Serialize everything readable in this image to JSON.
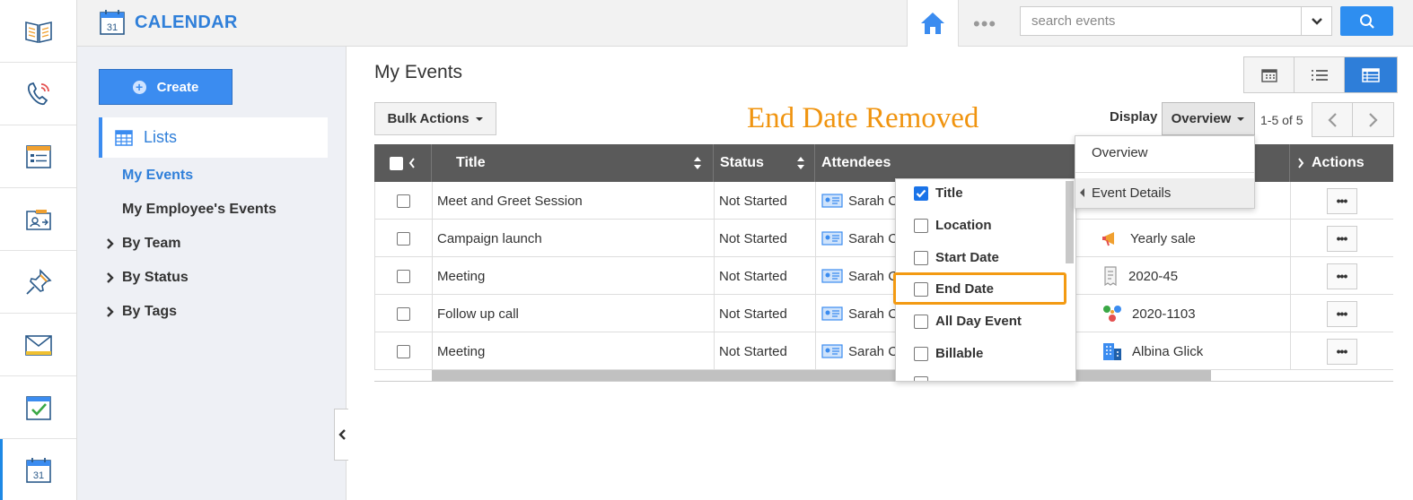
{
  "app": {
    "title": "CALENDAR",
    "calendar_day": "31"
  },
  "search": {
    "placeholder": "search events"
  },
  "header": {
    "dots": "•••"
  },
  "sidebar": {
    "create_label": "Create",
    "lists_label": "Lists",
    "links": [
      "My Events",
      "My Employee's Events"
    ],
    "groups": [
      "By Team",
      "By Status",
      "By Tags"
    ]
  },
  "main": {
    "title": "My Events",
    "bulk_actions": "Bulk Actions",
    "annotation": "End Date Removed",
    "display_label": "Display",
    "display_value": "Overview",
    "pager": "1-5 of 5"
  },
  "table": {
    "columns": {
      "title": "Title",
      "status": "Status",
      "attendees": "Attendees",
      "actions": "Actions"
    },
    "rows": [
      {
        "title": "Meet and Greet Session",
        "status": "Not Started",
        "attendee": "Sarah C",
        "related": ""
      },
      {
        "title": "Campaign launch",
        "status": "Not Started",
        "attendee": "Sarah C",
        "related": "Yearly sale"
      },
      {
        "title": "Meeting",
        "status": "Not Started",
        "attendee": "Sarah C",
        "related": "2020-45"
      },
      {
        "title": "Follow up call",
        "status": "Not Started",
        "attendee": "Sarah C",
        "related": "2020-1103"
      },
      {
        "title": "Meeting",
        "status": "Not Started",
        "attendee": "Sarah C",
        "related": "Albina Glick"
      }
    ],
    "action_dots": "•••"
  },
  "column_menu": {
    "options": [
      {
        "label": "Title",
        "checked": true
      },
      {
        "label": "Location",
        "checked": false
      },
      {
        "label": "Start Date",
        "checked": false
      },
      {
        "label": "End Date",
        "checked": false
      },
      {
        "label": "All Day Event",
        "checked": false
      },
      {
        "label": "Billable",
        "checked": false
      }
    ]
  },
  "display_menu": {
    "options": [
      "Overview",
      "Event Details"
    ]
  },
  "colors": {
    "accent": "#2f7fd9",
    "highlight": "#f39a12",
    "header_bg": "#5a5a5a"
  }
}
